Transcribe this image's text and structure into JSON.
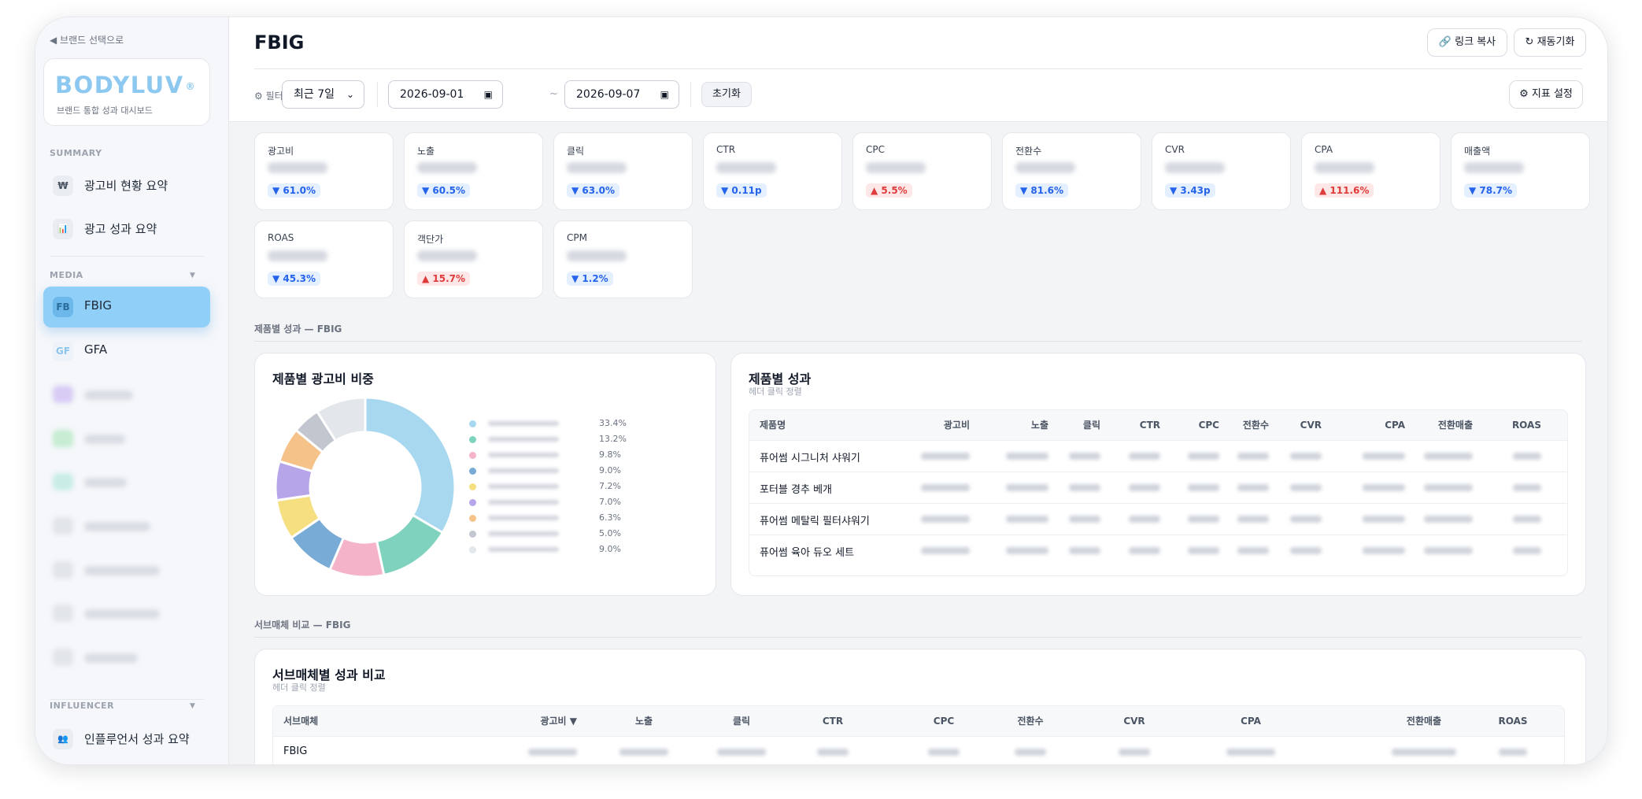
{
  "sidebar": {
    "back_label": "◀ 브랜드 선택으로",
    "brand_logo": "BODYLUV",
    "brand_logo_mark": "®",
    "brand_subtitle": "브랜드 통합 성과 대시보드",
    "sections": {
      "summary": "SUMMARY",
      "media": "MEDIA",
      "influencer": "INFLUENCER"
    },
    "summary_items": [
      {
        "icon": "₩",
        "icon_name": "won-icon",
        "label": "광고비 현황 요약"
      },
      {
        "icon": "📊",
        "icon_name": "bar-chart-icon",
        "label": "광고 성과 요약"
      }
    ],
    "media_items": [
      {
        "icon": "FB",
        "label": "FBIG",
        "active": true
      },
      {
        "icon": "GF",
        "label": "GFA",
        "active": false
      }
    ],
    "influencer_items": [
      {
        "icon": "👥",
        "icon_name": "people-icon",
        "label": "인플루언서 성과 요약"
      }
    ]
  },
  "header": {
    "title": "FBIG",
    "copy_link_label": "링크 복사",
    "resync_label": "재동기화",
    "filter_label": "필터",
    "period_select": "최근 7일",
    "date_from": "2026-09-01",
    "date_sep": "~",
    "date_to": "2026-09-07",
    "reset_label": "초기화",
    "metric_settings_label": "지표 설정"
  },
  "kpis": [
    {
      "name": "광고비",
      "change": "61.0%",
      "dir": "down"
    },
    {
      "name": "노출",
      "change": "60.5%",
      "dir": "down"
    },
    {
      "name": "클릭",
      "change": "63.0%",
      "dir": "down"
    },
    {
      "name": "CTR",
      "change": "0.11p",
      "dir": "down"
    },
    {
      "name": "CPC",
      "change": "5.5%",
      "dir": "up"
    },
    {
      "name": "전환수",
      "change": "81.6%",
      "dir": "down"
    },
    {
      "name": "CVR",
      "change": "3.43p",
      "dir": "down"
    },
    {
      "name": "CPA",
      "change": "111.6%",
      "dir": "up"
    },
    {
      "name": "매출액",
      "change": "78.7%",
      "dir": "down"
    },
    {
      "name": "ROAS",
      "change": "45.3%",
      "dir": "down"
    },
    {
      "name": "객단가",
      "change": "15.7%",
      "dir": "up"
    },
    {
      "name": "CPM",
      "change": "1.2%",
      "dir": "down"
    }
  ],
  "colors": {
    "accent": "#8fcff8",
    "down": "#2563eb",
    "up": "#e03b3b"
  },
  "product_section_title": "제품별 성과 — FBIG",
  "share_card": {
    "title": "제품별 광고비 비중"
  },
  "chart_data": {
    "type": "pie",
    "values": [
      33.4,
      13.2,
      9.8,
      9.0,
      7.2,
      7.0,
      6.3,
      5.0,
      9.0
    ],
    "labels": [
      "33.4%",
      "13.2%",
      "9.8%",
      "9.0%",
      "7.2%",
      "7.0%",
      "6.3%",
      "5.0%",
      "9.0%"
    ],
    "colors": [
      "#a8d8f0",
      "#7fd3be",
      "#f4b3c8",
      "#78acd6",
      "#f5df80",
      "#b7a5ea",
      "#f5c28a",
      "#c2c7cf",
      "#e3e6ea"
    ]
  },
  "product_table": {
    "title": "제품별 성과",
    "subtitle": "헤더 클릭 정렬",
    "columns": [
      "제품명",
      "광고비",
      "노출",
      "클릭",
      "CTR",
      "CPC",
      "전환수",
      "CVR",
      "CPA",
      "전환매출",
      "ROAS"
    ],
    "rows": [
      "퓨어썸 시그니처 샤워기",
      "포터블 경추 베개",
      "퓨어썸 메탈릭 필터샤워기",
      "퓨어썸 육아 듀오 세트"
    ]
  },
  "sub_section_title": "서브매체 비교 — FBIG",
  "sub_table": {
    "title": "서브매체별 성과 비교",
    "subtitle": "헤더 클릭 정렬",
    "columns": [
      "서브매체",
      "광고비 ▼",
      "노출",
      "클릭",
      "CTR",
      "CPC",
      "전환수",
      "CVR",
      "CPA",
      "전환매출",
      "ROAS"
    ],
    "rows": [
      "FBIG"
    ]
  }
}
